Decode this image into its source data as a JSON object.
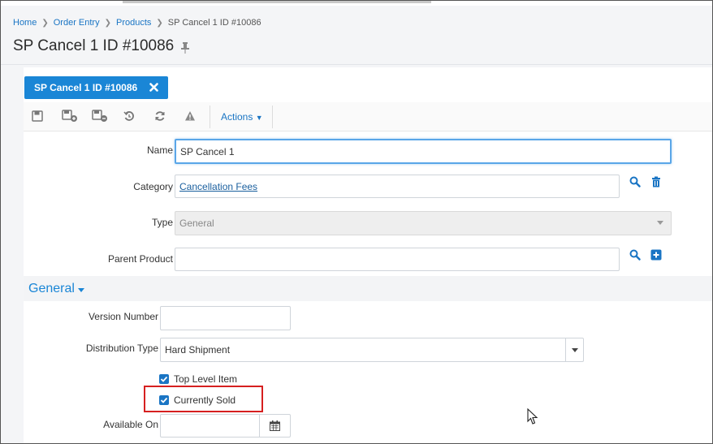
{
  "breadcrumb": [
    {
      "label": "Home"
    },
    {
      "label": "Order Entry"
    },
    {
      "label": "Products"
    },
    {
      "label": "SP Cancel 1 ID #10086"
    }
  ],
  "page_title": "SP Cancel 1 ID #10086",
  "tab": {
    "label": "SP Cancel 1 ID #10086"
  },
  "toolbar": {
    "icons": [
      "save-icon",
      "save-and-new-icon",
      "save-and-add-icon",
      "undo-icon",
      "refresh-icon",
      "warning-icon"
    ],
    "actions_label": "Actions"
  },
  "form": {
    "name": {
      "label": "Name",
      "value": "SP Cancel 1"
    },
    "category": {
      "label": "Category",
      "value": "Cancellation Fees"
    },
    "type": {
      "label": "Type",
      "value": "General"
    },
    "parent_product": {
      "label": "Parent Product",
      "value": ""
    }
  },
  "general": {
    "title": "General",
    "version_number": {
      "label": "Version Number",
      "value": ""
    },
    "distribution_type": {
      "label": "Distribution Type",
      "value": "Hard Shipment"
    },
    "top_level_item": {
      "label": "Top Level Item",
      "checked": true
    },
    "currently_sold": {
      "label": "Currently Sold",
      "checked": true
    },
    "available_on": {
      "label": "Available On",
      "value": ""
    }
  },
  "colors": {
    "accent": "#1a86d6",
    "highlight": "#d62020"
  }
}
